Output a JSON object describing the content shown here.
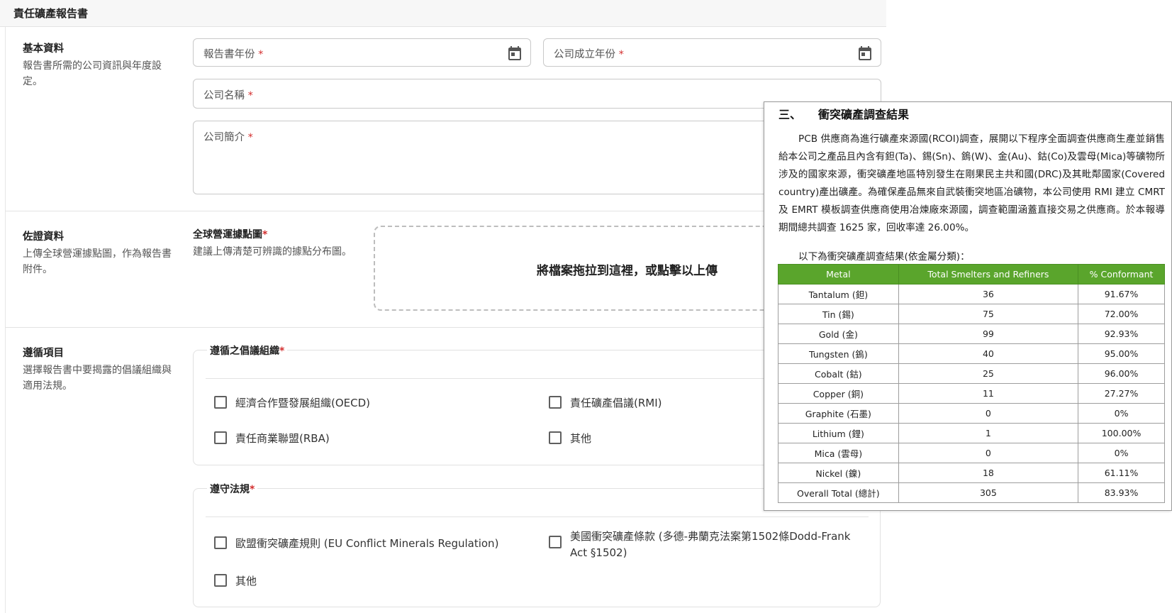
{
  "app": {
    "title": "責任礦產報告書"
  },
  "basic": {
    "title": "基本資料",
    "desc": "報告書所需的公司資訊與年度設定。",
    "report_year": "報告書年份",
    "founded_year": "公司成立年份",
    "company_name": "公司名稱",
    "company_intro": "公司簡介",
    "required_mark": "*",
    "calendar_icon": "calendar-icon"
  },
  "evidence": {
    "title": "佐證資料",
    "desc": "上傳全球營運據點圖，作為報告書附件。",
    "field_title": "全球營運據點圖",
    "field_desc": "建議上傳清楚可辨識的據點分布圖。",
    "dropzone": "將檔案拖拉到這裡，或點擊以上傳"
  },
  "compliance": {
    "title": "遵循項目",
    "desc": "選擇報告書中要揭露的倡議組織與適用法規。",
    "initiatives": {
      "legend": "遵循之倡議組織",
      "options": [
        "經濟合作暨發展組織(OECD)",
        "責任礦產倡議(RMI)",
        "責任商業聯盟(RBA)",
        "其他"
      ]
    },
    "regulations": {
      "legend": "遵守法規",
      "options": [
        "歐盟衝突礦產規則 (EU Conflict Minerals Regulation)",
        "美國衝突礦產條款 (多德-弗蘭克法案第1502條Dodd-Frank Act §1502)",
        "其他"
      ]
    }
  },
  "document": {
    "heading": "三、　　衝突礦產調查結果",
    "paragraph": "PCB 供應商為進行礦產來源國(RCOI)調查，展開以下程序全面調查供應商生產並銷售給本公司之產品且內含有鉭(Ta)、錫(Sn)、鎢(W)、金(Au)、鈷(Co)及雲母(Mica)等礦物所涉及的國家來源，衝突礦產地區特別發生在剛果民主共和國(DRC)及其毗鄰國家(Covered country)產出礦產。為確保產品無來自武裝衝突地區冶礦物，本公司使用 RMI 建立 CMRT 及 EMRT 模板調查供應商使用冶煉廠來源國，調查範圍涵蓋直接交易之供應商。於本報導期間總共調查 1625 家，回收率達 26.00%。",
    "intro": "以下為衝突礦產調查結果(依金屬分類)：",
    "table": {
      "headers": [
        "Metal",
        "Total Smelters and Refiners",
        "% Conformant"
      ],
      "rows": [
        [
          "Tantalum (鉭)",
          "36",
          "91.67%"
        ],
        [
          "Tin (錫)",
          "75",
          "72.00%"
        ],
        [
          "Gold (金)",
          "99",
          "92.93%"
        ],
        [
          "Tungsten (鎢)",
          "40",
          "95.00%"
        ],
        [
          "Cobalt (鈷)",
          "25",
          "96.00%"
        ],
        [
          "Copper (銅)",
          "11",
          "27.27%"
        ],
        [
          "Graphite (石墨)",
          "0",
          "0%"
        ],
        [
          "Lithium (鋰)",
          "1",
          "100.00%"
        ],
        [
          "Mica (雲母)",
          "0",
          "0%"
        ],
        [
          "Nickel (鎳)",
          "18",
          "61.11%"
        ],
        [
          "Overall Total (總計)",
          "305",
          "83.93%"
        ]
      ]
    }
  }
}
